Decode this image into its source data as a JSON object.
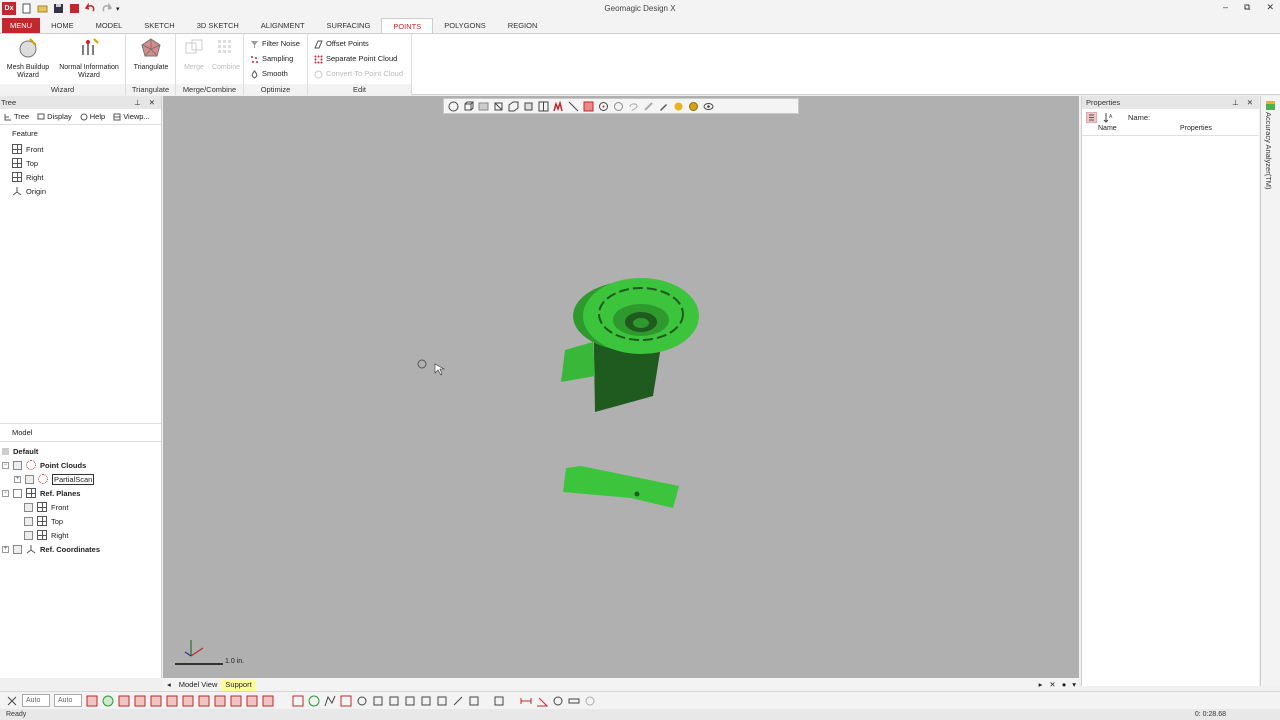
{
  "window": {
    "title": "Geomagic Design X",
    "logo_text": "Dx",
    "minimize": "–",
    "restore": "⧉",
    "close": "✕"
  },
  "ribbon_tabs": [
    "HOME",
    "MODEL",
    "SKETCH",
    "3D SKETCH",
    "ALIGNMENT",
    "SURFACING",
    "POINTS",
    "POLYGONS",
    "REGION"
  ],
  "menu_label": "MENU",
  "active_tab": "POINTS",
  "ribbon": {
    "wizard": {
      "label": "Wizard",
      "mesh_buildup": "Mesh Buildup Wizard",
      "normal_info": "Normal Information Wizard"
    },
    "triangulate": {
      "label": "Triangulate",
      "button": "Triangulate"
    },
    "merge_combine": {
      "label": "Merge/Combine",
      "merge": "Merge",
      "combine": "Combine"
    },
    "optimize": {
      "label": "Optimize",
      "filter_noise": "Filter Noise",
      "sampling": "Sampling",
      "smooth": "Smooth"
    },
    "edit": {
      "label": "Edit",
      "offset_points": "Offset Points",
      "separate_point_cloud": "Separate Point Cloud",
      "convert_to_point_cloud": "Convert To Point Cloud"
    }
  },
  "tree_panel": {
    "title": "Tree",
    "subtabs": [
      "Tree",
      "Display",
      "Help",
      "Viewp..."
    ],
    "feature_label": "Feature",
    "features": [
      "Front",
      "Top",
      "Right",
      "Origin"
    ],
    "model_label": "Model",
    "model_root": "Default",
    "point_clouds": "Point Clouds",
    "partial_scan": "PartialScan",
    "ref_planes": "Ref. Planes",
    "planes": [
      "Front",
      "Top",
      "Right"
    ],
    "ref_coordinates": "Ref. Coordinates"
  },
  "properties_panel": {
    "title": "Properties",
    "name_label": "Name:",
    "col_name": "Name",
    "col_properties": "Properties"
  },
  "side_tab": "Accuracy Analyzer(TM)",
  "viewport": {
    "scale_label": "1.0 in.",
    "bg_color": "#b0b0b0",
    "mesh_color": "#3cc43c"
  },
  "view_tabs": [
    "Model View",
    "Support"
  ],
  "bottom_toolbar": {
    "combo1": "Auto",
    "combo2": "Auto"
  },
  "status": {
    "text": "Ready",
    "time": "0: 0:28.68"
  }
}
